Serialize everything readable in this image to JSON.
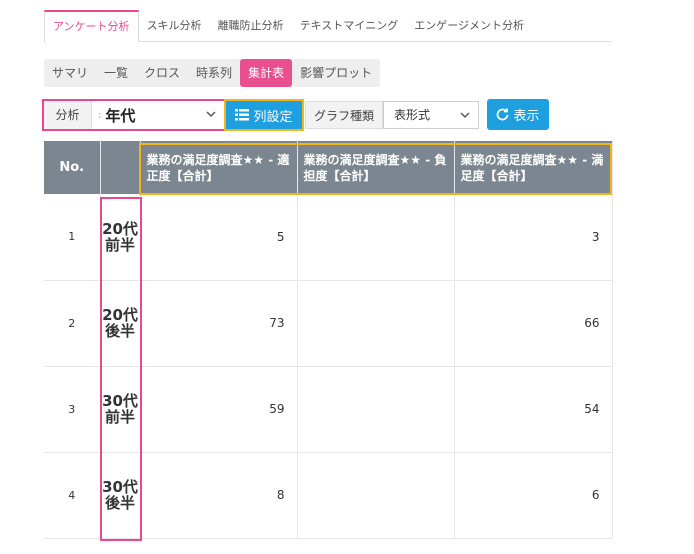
{
  "top_tabs": [
    "アンケート分析",
    "スキル分析",
    "離職防止分析",
    "テキストマイニング",
    "エンゲージメント分析"
  ],
  "sub_tabs": [
    "サマリ",
    "一覧",
    "クロス",
    "時系列",
    "集計表",
    "影響プロット"
  ],
  "controls": {
    "analysis_label": "分析",
    "analysis_value": "年代",
    "column_setting_label": "列設定",
    "graph_type_label": "グラフ種類",
    "graph_type_value": "表形式",
    "show_label": "表示"
  },
  "table": {
    "no_header": "No.",
    "columns": [
      "業務の満足度調査★★ - 適正度【合計】",
      "業務の満足度調査★★ - 負担度【合計】",
      "業務の満足度調査★★ - 満足度【合計】"
    ],
    "rows": [
      {
        "no": "1",
        "label": "20代前半",
        "values": [
          "5",
          "",
          "3"
        ]
      },
      {
        "no": "2",
        "label": "20代後半",
        "values": [
          "73",
          "",
          "66"
        ]
      },
      {
        "no": "3",
        "label": "30代前半",
        "values": [
          "59",
          "",
          "54"
        ]
      },
      {
        "no": "4",
        "label": "30代後半",
        "values": [
          "8",
          "",
          "6"
        ]
      }
    ]
  },
  "colors": {
    "accent_pink": "#e8488f",
    "highlight_yellow": "#f0b51c",
    "button_blue": "#1e9fe0",
    "header_gray": "#7c8690"
  }
}
